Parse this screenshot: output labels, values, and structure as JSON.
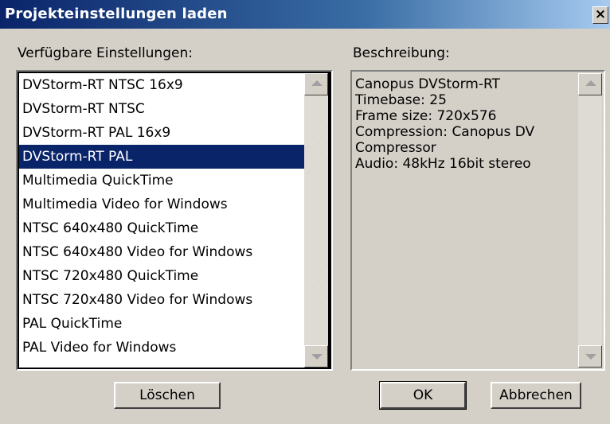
{
  "window": {
    "title": "Projekteinstellungen laden",
    "close_label": "×"
  },
  "available_settings": {
    "label": "Verfügbare Einstellungen:",
    "items": [
      "DVStorm-RT NTSC 16x9",
      "DVStorm-RT NTSC",
      "DVStorm-RT PAL 16x9",
      "DVStorm-RT PAL",
      "Multimedia QuickTime",
      "Multimedia Video for Windows",
      "NTSC 640x480 QuickTime",
      "NTSC 640x480 Video for Windows",
      "NTSC 720x480 QuickTime",
      "NTSC 720x480 Video for Windows",
      "PAL QuickTime",
      "PAL Video for Windows"
    ],
    "selected_index": 3
  },
  "description": {
    "label": "Beschreibung:",
    "lines": [
      "Canopus DVStorm-RT",
      "Timebase: 25",
      "Frame size: 720x576",
      "Compression: Canopus DV",
      "Compressor",
      "Audio: 48kHz 16bit stereo"
    ]
  },
  "buttons": {
    "delete_label": "Löschen",
    "ok_label": "OK",
    "cancel_label": "Abbrechen"
  },
  "colors": {
    "dialog_bg": "#d4d0c8",
    "titlebar_start": "#0a246a",
    "titlebar_end": "#a6caf0",
    "selection_bg": "#0a246a",
    "selection_text": "#ffffff"
  },
  "icons": {
    "scroll_up": "scroll-up-arrow-icon",
    "scroll_down": "scroll-down-arrow-icon",
    "close": "close-icon"
  }
}
